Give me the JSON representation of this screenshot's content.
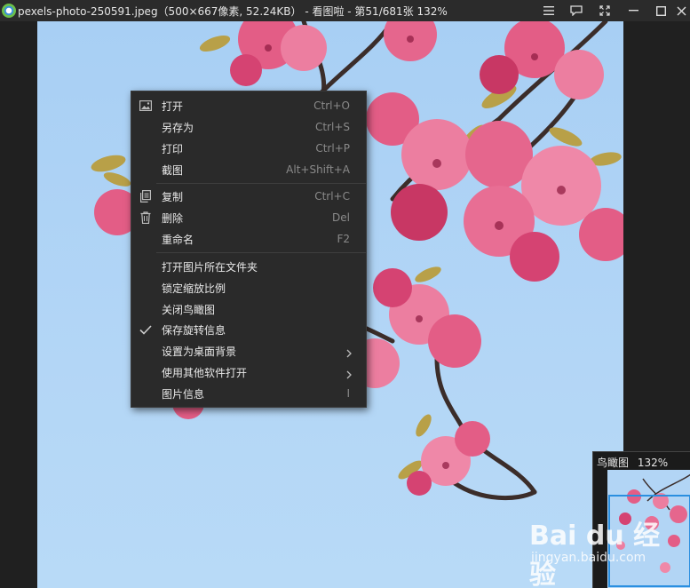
{
  "titlebar": {
    "title": "pexels-photo-250591.jpeg（500×667像素, 52.24KB） - 看图啦 - 第51/681张 132%"
  },
  "menu": {
    "items": [
      {
        "label": "打开",
        "shortcut": "Ctrl+O",
        "icon": "image-icon"
      },
      {
        "label": "另存为",
        "shortcut": "Ctrl+S"
      },
      {
        "label": "打印",
        "shortcut": "Ctrl+P"
      },
      {
        "label": "截图",
        "shortcut": "Alt+Shift+A"
      },
      {
        "label": "复制",
        "shortcut": "Ctrl+C",
        "icon": "copy-icon"
      },
      {
        "label": "删除",
        "shortcut": "Del",
        "icon": "trash-icon"
      },
      {
        "label": "重命名",
        "shortcut": "F2"
      },
      {
        "label": "打开图片所在文件夹"
      },
      {
        "label": "锁定缩放比例"
      },
      {
        "label": "关闭鸟瞰图"
      },
      {
        "label": "保存旋转信息",
        "checked": true
      },
      {
        "label": "设置为桌面背景",
        "submenu": true
      },
      {
        "label": "使用其他软件打开",
        "submenu": true
      },
      {
        "label": "图片信息",
        "shortcut": "I"
      }
    ]
  },
  "birdseye": {
    "title": "鸟瞰图",
    "zoom": "132%"
  },
  "watermark": {
    "logo": "Bai du 经验",
    "url": "jingyan.baidu.com"
  },
  "colors": {
    "sky": "#a8cff4",
    "blossom": "#e0507a",
    "menu_bg": "#2a2a2a",
    "accent": "#2a8fe0"
  }
}
